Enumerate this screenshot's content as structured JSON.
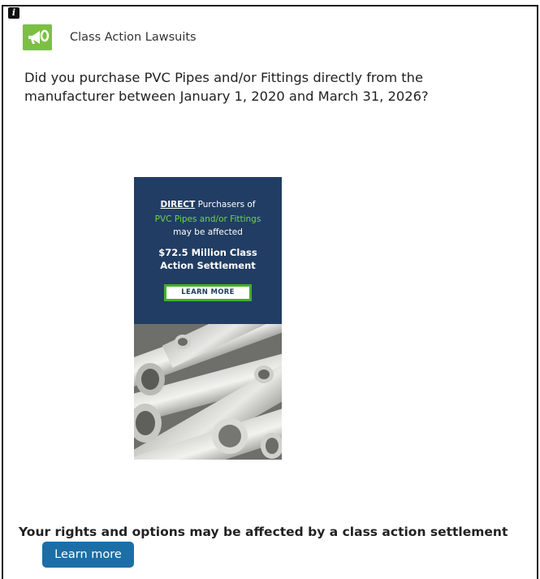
{
  "badge": {
    "glyph": "i",
    "icon": "info-icon"
  },
  "sponsor": {
    "name": "Class Action Lawsuits",
    "icon": "megaphone-icon",
    "icon_color": "#7bc043"
  },
  "headline": "Did you purchase PVC Pipes and/or Fittings directly from the manufacturer between January 1, 2020 and March 31, 2026?",
  "ad": {
    "direct_label": "DIRECT",
    "line1_rest": " Purchasers of",
    "line2": "PVC Pipes and/or Fittings",
    "line3": "may be affected",
    "money_line1": "$72.5 Million Class",
    "money_line2": "Action Settlement",
    "cta_label": "LEARN MORE",
    "panel_color": "#213d63",
    "accent_color": "#6fd44a"
  },
  "footer": {
    "text": "Your rights and options may be affected by a class action settlement",
    "button_label": "Learn more",
    "button_color": "#1b6fa6"
  }
}
